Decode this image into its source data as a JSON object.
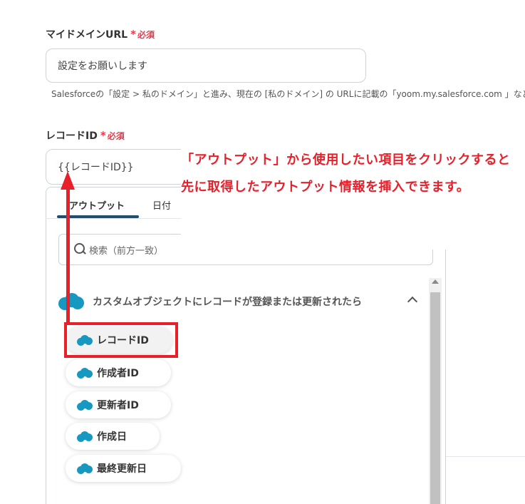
{
  "fields": {
    "domain_url": {
      "label": "マイドメインURL",
      "required_star": "*",
      "required_text": "必須",
      "value": "設定をお願いします",
      "help": "Salesforceの「設定 > 私のドメイン」と進み、現在の [私のドメイン] の URLに記載の「yoom.my.salesforce.com 」など"
    },
    "record_id": {
      "label": "レコードID",
      "required_star": "*",
      "required_text": "必須",
      "value": "{{レコードID}}"
    }
  },
  "dropdown": {
    "tabs": [
      {
        "label": "アウトプット",
        "active": true
      },
      {
        "label": "日付",
        "active": false
      }
    ],
    "search_placeholder": "検索（前方一致）",
    "group": {
      "label": "カスタムオブジェクトにレコードが登録または更新されたら",
      "icon": "salesforce-cloud-icon",
      "expanded": true
    },
    "items": [
      {
        "label": "レコードID",
        "highlighted": true
      },
      {
        "label": "作成者ID"
      },
      {
        "label": "更新者ID"
      },
      {
        "label": "作成日"
      },
      {
        "label": "最終更新日"
      }
    ]
  },
  "annotation": {
    "line1": "「アウトプット」から使用したい項目をクリックすると",
    "line2": "先に取得したアウトプット情報を挿入できます。",
    "color": "#e8202a"
  },
  "colors": {
    "required": "#e53a4a",
    "salesforce": "#1798c1",
    "tab_active": "#1d4f72"
  }
}
